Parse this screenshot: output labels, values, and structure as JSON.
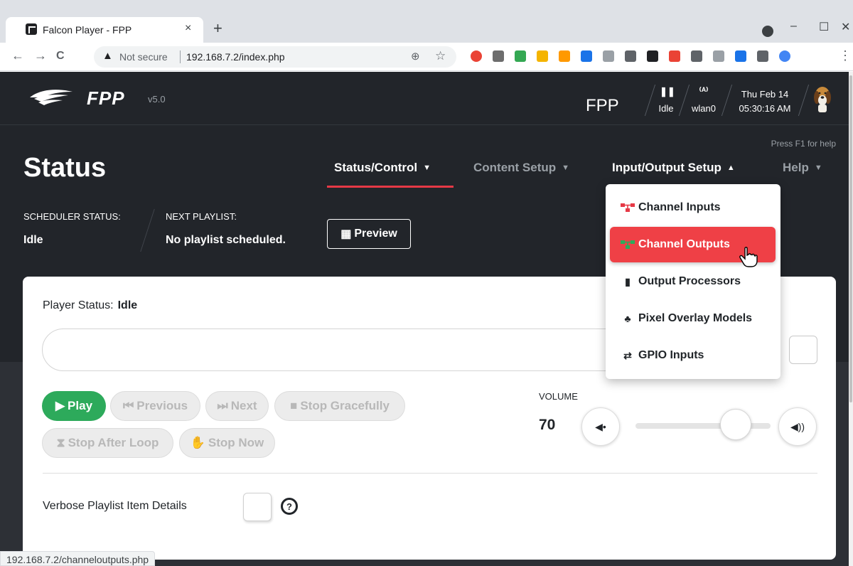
{
  "browser": {
    "tab_title": "Falcon Player - FPP",
    "tab_close": "×",
    "new_tab": "+",
    "window_controls": [
      "–",
      "☐",
      "✕"
    ],
    "nav": {
      "back": "←",
      "forward": "→",
      "reload": "C"
    },
    "security_label": "Not secure",
    "url": "192.168.7.2/index.php",
    "extension_colors": [
      "#ea4335",
      "#6d6d6d",
      "#34a853",
      "#f4b400",
      "#ff9900",
      "#1a73e8",
      "#9aa0a6",
      "#5f6368",
      "#202124",
      "#ea4335",
      "#5f6368",
      "#9aa0a6",
      "#1a73e8",
      "#5f6368",
      "#4285f4"
    ],
    "status_url": "192.168.7.2/channeloutputs.php"
  },
  "header": {
    "brand": "FPP",
    "version": "v5.0",
    "host": "FPP",
    "player_state": "Idle",
    "network": "wlan0",
    "date": "Thu Feb 14",
    "time": "05:30:16 AM",
    "help_hint": "Press F1 for help"
  },
  "page": {
    "title": "Status"
  },
  "mainnav": [
    {
      "label": "Status/Control",
      "caret": "▼"
    },
    {
      "label": "Content Setup",
      "caret": "▼"
    },
    {
      "label": "Input/Output Setup",
      "caret": "▲"
    },
    {
      "label": "Help",
      "caret": "▼"
    }
  ],
  "scheduler": {
    "status_label": "SCHEDULER STATUS:",
    "status_value": "Idle",
    "next_label": "NEXT PLAYLIST:",
    "next_value": "No playlist scheduled.",
    "preview_label": "Preview"
  },
  "player": {
    "status_label": "Player Status:",
    "status_value": "Idle",
    "buttons": {
      "play": "Play",
      "previous": "Previous",
      "next": "Next",
      "stop_gracefully": "Stop Gracefully",
      "stop_after_loop": "Stop After Loop",
      "stop_now": "Stop Now"
    },
    "volume_label": "VOLUME",
    "volume_value": "70",
    "volume_level": 0.7,
    "verbose_label": "Verbose Playlist Item Details",
    "help_icon": "?"
  },
  "dropdown": {
    "items": [
      {
        "label": "Channel Inputs",
        "icon": "sitemap-icon"
      },
      {
        "label": "Channel Outputs",
        "icon": "sitemap-icon",
        "active": true
      },
      {
        "label": "Output Processors",
        "icon": "chip-icon"
      },
      {
        "label": "Pixel Overlay Models",
        "icon": "shapes-icon"
      },
      {
        "label": "GPIO Inputs",
        "icon": "exchange-icon"
      }
    ]
  },
  "colors": {
    "accent": "#e63946",
    "play_green": "#2daa5b",
    "active_item": "#ef4046",
    "page_bg": "#22252a"
  }
}
